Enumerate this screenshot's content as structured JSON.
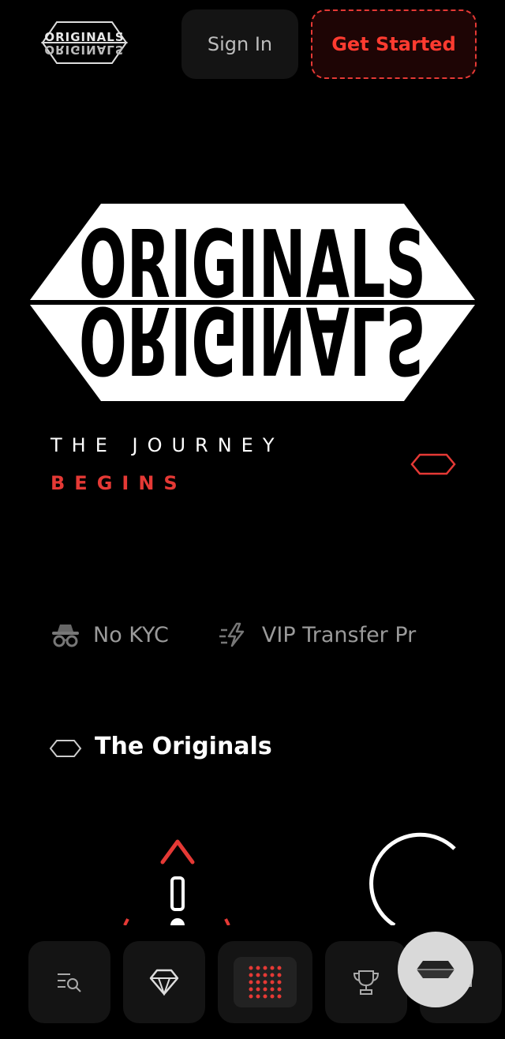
{
  "header": {
    "sign_in_label": "Sign In",
    "get_started_label": "Get Started"
  },
  "brand": {
    "logo_text": "ORIGINALS"
  },
  "hero": {
    "tagline_line1": "THE JOURNEY",
    "tagline_line2": "BEGINS"
  },
  "features": [
    {
      "icon": "incognito-icon",
      "label": "No KYC"
    },
    {
      "icon": "fast-transfer-icon",
      "label": "VIP Transfer Pr"
    }
  ],
  "section": {
    "title": "The Originals"
  },
  "bottom_nav": {
    "items": [
      {
        "icon": "search-list-icon"
      },
      {
        "icon": "diamond-icon"
      },
      {
        "icon": "games-grid-icon",
        "active": true
      },
      {
        "icon": "trophy-icon"
      },
      {
        "icon": "chat-icon"
      }
    ]
  },
  "colors": {
    "background": "#000000",
    "accent": "#e53935",
    "button_surface": "#141414",
    "muted_text": "#9a9a9a"
  }
}
